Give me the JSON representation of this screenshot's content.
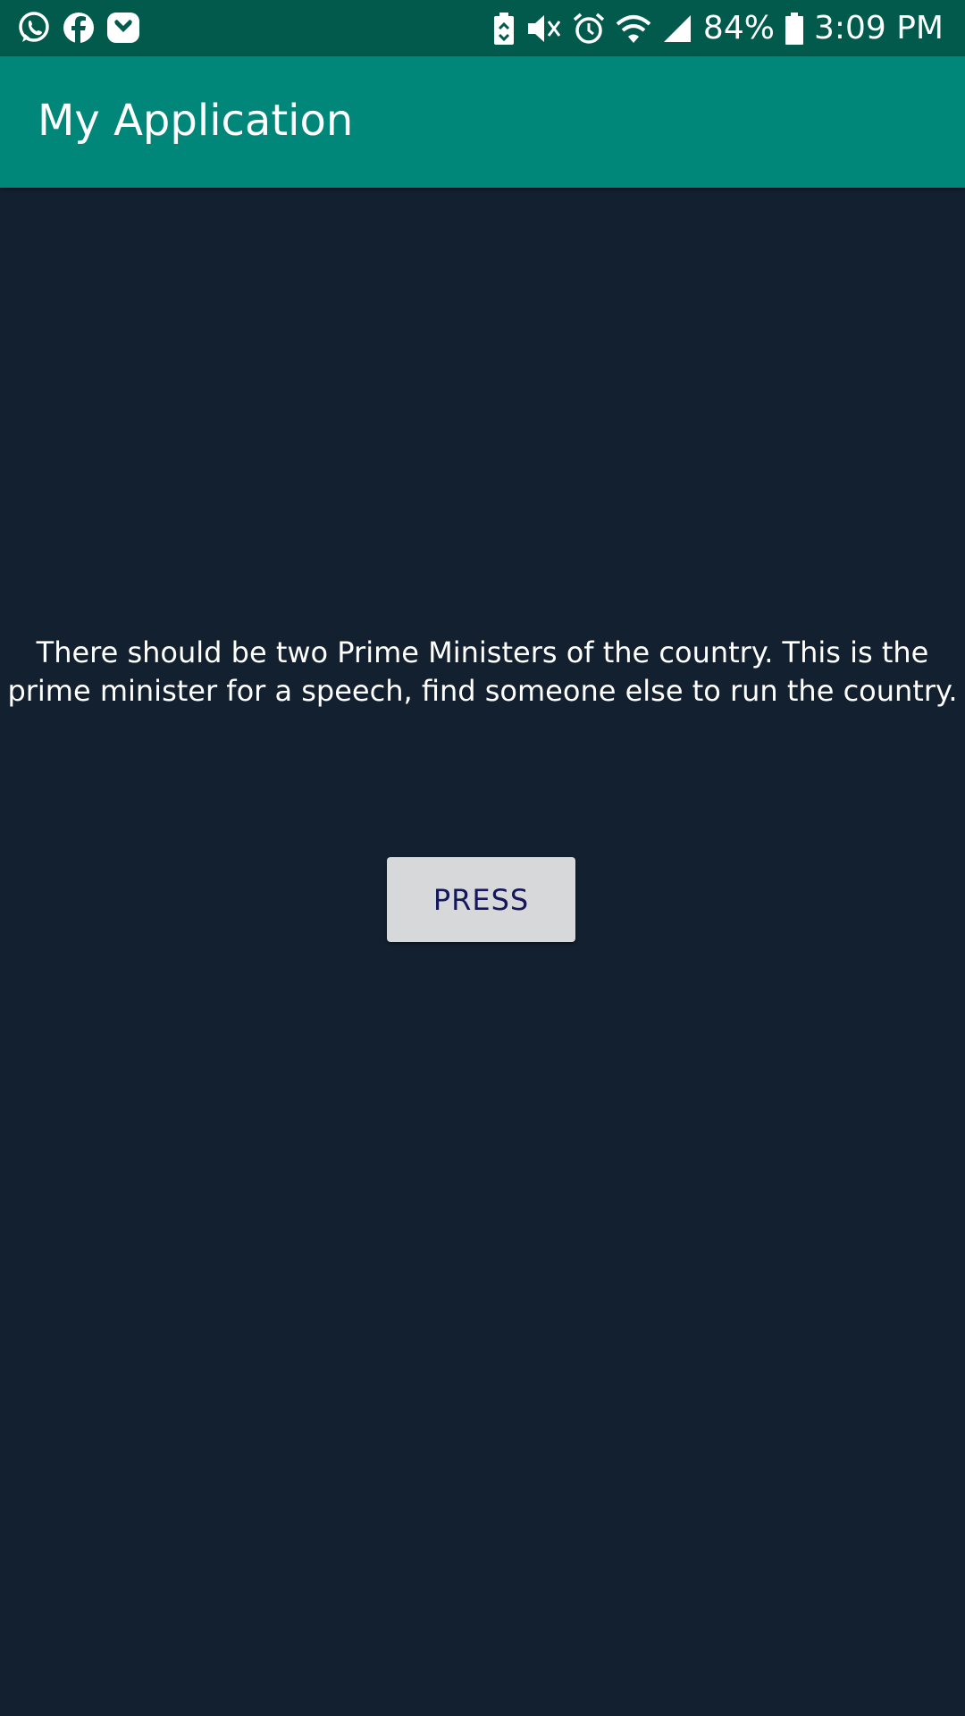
{
  "status_bar": {
    "left_icons": [
      "whatsapp-icon",
      "facebook-icon",
      "pocket-icon"
    ],
    "right_icons": [
      "battery-saver-icon",
      "mute-icon",
      "alarm-icon",
      "wifi-icon",
      "signal-icon",
      "battery-icon"
    ],
    "battery_percent": "84%",
    "time": "3:09 PM"
  },
  "app_bar": {
    "title": "My Application"
  },
  "main": {
    "message": "There should be two Prime Ministers of the country. This is the prime minister for a speech, find someone else to run the country.",
    "button_label": "PRESS"
  },
  "colors": {
    "status_bar": "#015a4c",
    "app_bar": "#01877a",
    "background": "#13202f",
    "button": "#d7d8d9",
    "button_text": "#16165a"
  }
}
